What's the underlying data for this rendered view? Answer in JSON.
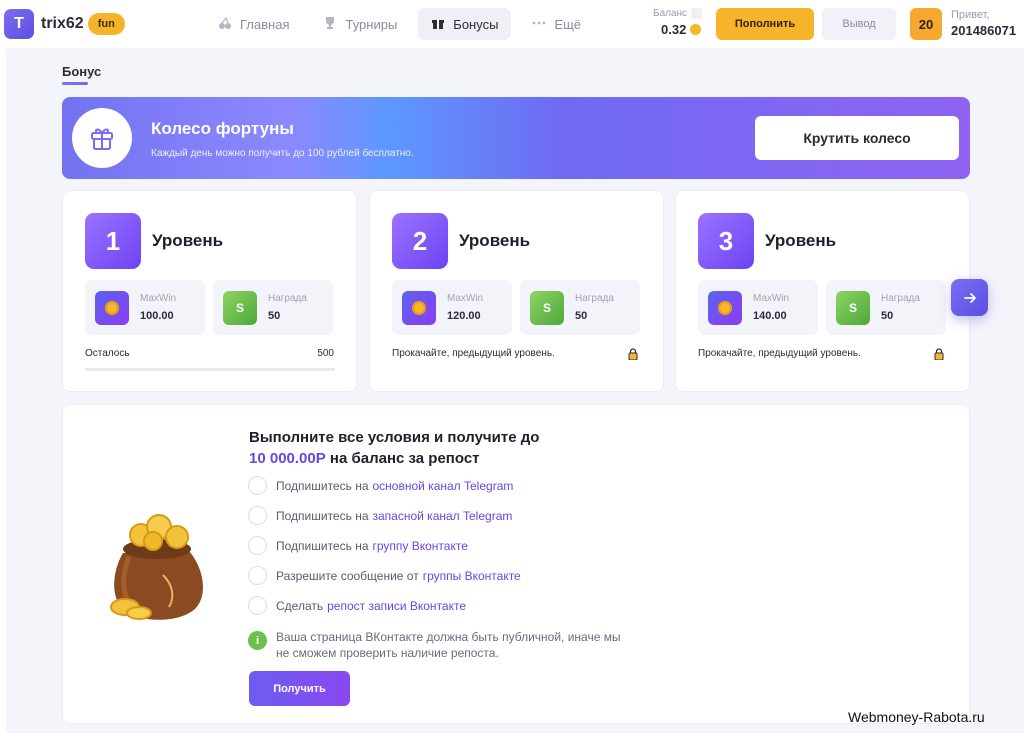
{
  "header": {
    "logo_letter": "T",
    "logo_text": "trix62",
    "logo_badge": "fun",
    "nav": [
      {
        "label": "Главная",
        "icon": "cherries-icon"
      },
      {
        "label": "Турниры",
        "icon": "trophy-icon"
      },
      {
        "label": "Бонусы",
        "icon": "gift-icon",
        "active": true
      },
      {
        "label": "Ещё",
        "icon": "more-dots-icon"
      }
    ],
    "balance_label": "Баланс",
    "balance_value": "0.32",
    "deposit_label": "Пополнить",
    "withdraw_label": "Вывод",
    "user_level": "20",
    "greeting": "Привет,",
    "user_id": "201486071"
  },
  "page": {
    "section_title": "Бонус"
  },
  "wheel": {
    "title": "Колесо фортуны",
    "subtitle": "Каждый день можно получить до 100 рублей бесплатно.",
    "button": "Крутить колесо"
  },
  "levels": [
    {
      "number": "1",
      "title": "Уровень",
      "maxwin_label": "MaxWin",
      "maxwin": "100.00",
      "reward_label": "Награда",
      "reward": "50",
      "reward_icon_letter": "S",
      "remain_label": "Осталось",
      "remain_value": "500",
      "remain_progress": 0.0
    },
    {
      "number": "2",
      "title": "Уровень",
      "maxwin_label": "MaxWin",
      "maxwin": "120.00",
      "reward_label": "Награда",
      "reward": "50",
      "reward_icon_letter": "S",
      "locked_text": "Прокачайте, предыдущий уровень."
    },
    {
      "number": "3",
      "title": "Уровень",
      "maxwin_label": "MaxWin",
      "maxwin": "140.00",
      "reward_label": "Награда",
      "reward": "50",
      "reward_icon_letter": "S",
      "locked_text": "Прокачайте, предыдущий уровень."
    }
  ],
  "repost": {
    "title_line1": "Выполните все условия и получите до",
    "amount": "10 000.00Р",
    "title_line2_rest": " на баланс за репост",
    "conditions": [
      {
        "text": "Подпишитесь на",
        "link": "основной канал Telegram"
      },
      {
        "text": "Подпишитесь на",
        "link": "запасной канал Telegram"
      },
      {
        "text": "Подпишитесь на",
        "link": "группу Вконтакте"
      },
      {
        "text": "Разрешите сообщение от",
        "link": "группы Вконтакте"
      },
      {
        "text": "Сделать",
        "link": "репост записи Вконтакте"
      }
    ],
    "info_icon_letter": "i",
    "info_text": "Ваша страница ВКонтакте должна быть публичной, иначе мы не сможем проверить наличие репоста.",
    "button": "Получить"
  },
  "watermark": "Webmoney-Rabota.ru"
}
